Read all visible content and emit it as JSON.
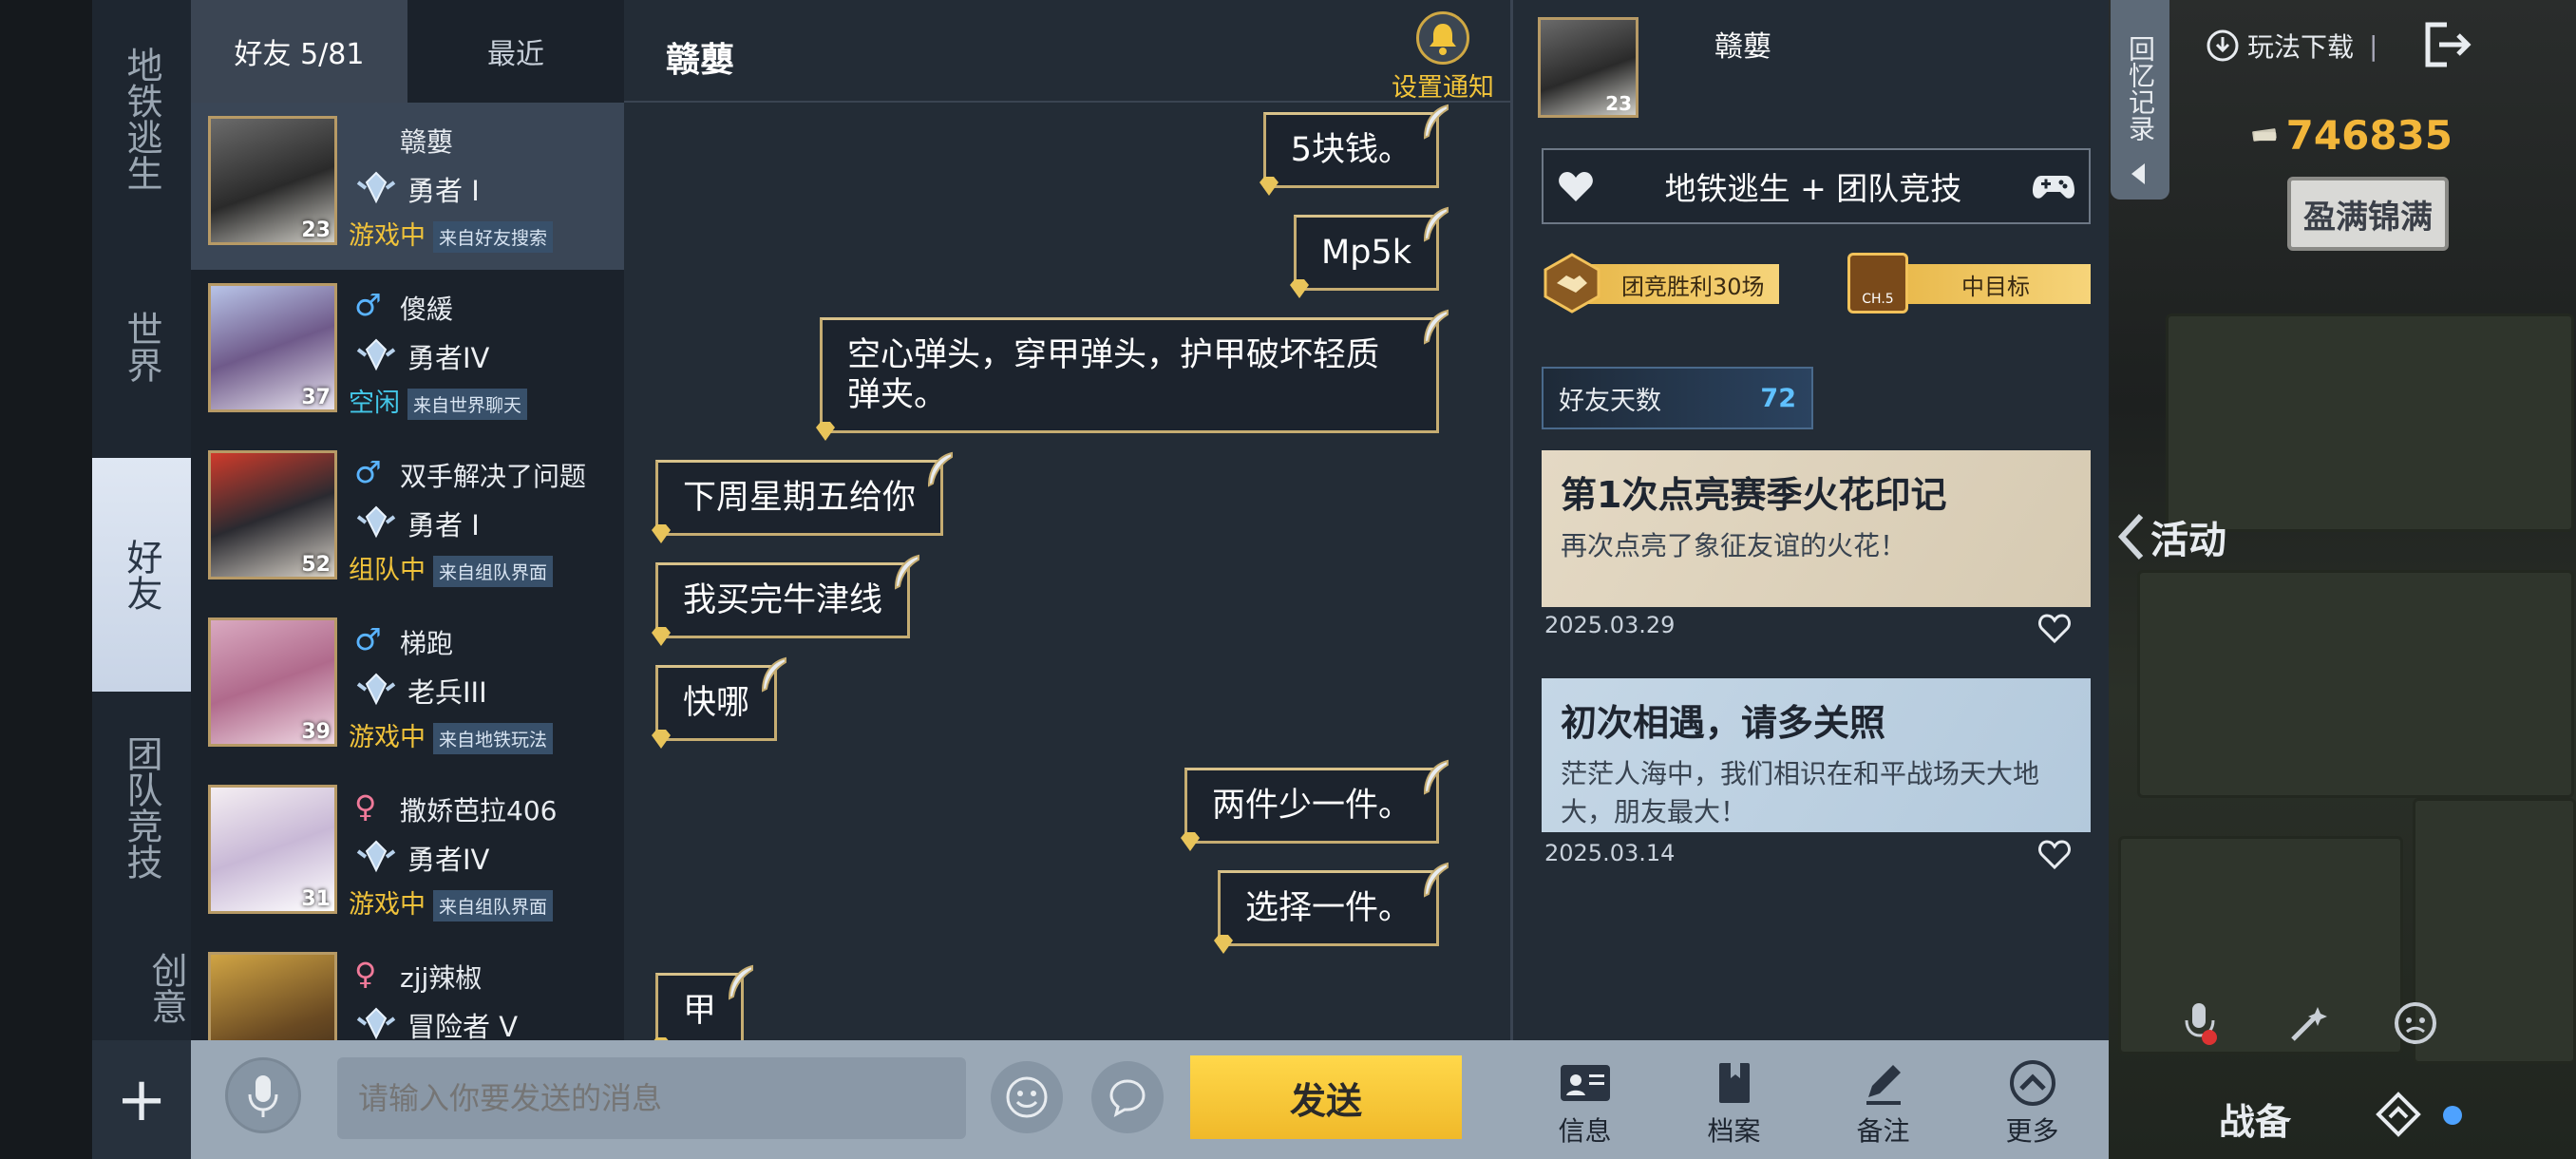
{
  "categories": [
    "地铁逃生",
    "世界",
    "好友",
    "团队竞技",
    "创意"
  ],
  "friends_tabs": {
    "friends": "好友 5/81",
    "recent": "最近"
  },
  "friends": [
    {
      "name": "赣蘡",
      "rank": "勇者 I",
      "status": "游戏中",
      "source": "来自好友搜索",
      "level": "23",
      "gender": "",
      "status_color": "#f0c23a"
    },
    {
      "name": "傻緩",
      "rank": "勇者IV",
      "status": "空闲",
      "source": "来自世界聊天",
      "level": "37",
      "gender": "♂",
      "status_color": "#43c7e8"
    },
    {
      "name": "双手解决了问题",
      "rank": "勇者 I",
      "status": "组队中",
      "source": "来自组队界面",
      "level": "52",
      "gender": "♂",
      "status_color": "#f0c23a"
    },
    {
      "name": "梯跑",
      "rank": "老兵III",
      "status": "游戏中",
      "source": "来自地铁玩法",
      "level": "39",
      "gender": "♂",
      "status_color": "#f0c23a"
    },
    {
      "name": "撒娇芭拉406",
      "rank": "勇者IV",
      "status": "游戏中",
      "source": "来自组队界面",
      "level": "31",
      "gender": "♀",
      "status_color": "#f0c23a"
    },
    {
      "name": "zjj辣椒",
      "rank": "冒险者 V",
      "status": "",
      "source": "",
      "level": "",
      "gender": "♀",
      "status_color": "#f0c23a"
    }
  ],
  "chat": {
    "title": "赣蘡",
    "notify_label": "设置通知",
    "messages": [
      {
        "side": "right",
        "text": "5块钱。"
      },
      {
        "side": "right",
        "text": "Mp5k"
      },
      {
        "side": "right",
        "text": "空心弹头，穿甲弹头，护甲破坏轻质弹夹。"
      },
      {
        "side": "left",
        "text": "下周星期五给你"
      },
      {
        "side": "left",
        "text": "我买完牛津线"
      },
      {
        "side": "left",
        "text": "快哪"
      },
      {
        "side": "right",
        "text": "两件少一件。"
      },
      {
        "side": "right",
        "text": "选择一件。"
      },
      {
        "side": "left",
        "text": "甲"
      }
    ]
  },
  "input": {
    "placeholder": "请输入你要发送的消息",
    "send_label": "发送"
  },
  "profile": {
    "name": "赣蘡",
    "level": "23",
    "modes": "地铁逃生 + 团队竞技",
    "badges": [
      "团竞胜利30场",
      "中目标"
    ],
    "badge_tag": "CH.5",
    "friend_days_label": "好友天数",
    "friend_days": "72",
    "cards": [
      {
        "title": "第1次点亮赛季火花印记",
        "text": "再次点亮了象征友谊的火花！",
        "date": "2025.03.29"
      },
      {
        "title": "初次相遇，请多关照",
        "text": "茫茫人海中，我们相识在和平战场天大地大，朋友最大！",
        "date": "2025.03.14"
      }
    ],
    "tabs": [
      "信息",
      "档案",
      "备注",
      "更多"
    ]
  },
  "memory_tab": "回忆记录",
  "right_hud": {
    "download": "玩法下载",
    "currency": "746835",
    "logo_text": "盈满锦满",
    "activity": "活动",
    "equip": "战备"
  }
}
